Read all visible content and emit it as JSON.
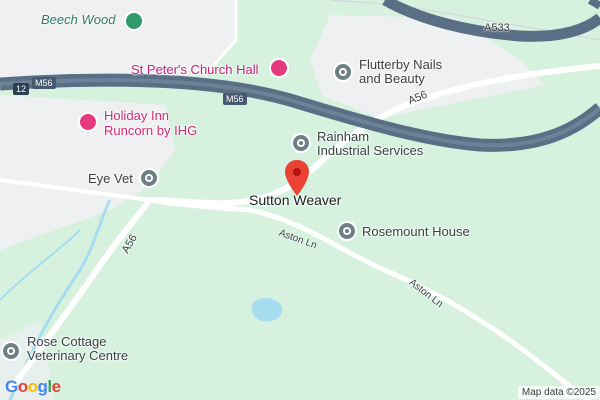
{
  "map": {
    "places": [
      {
        "id": "beech-wood",
        "label": "Beech Wood",
        "color": "#2f7d61"
      },
      {
        "id": "st-peters",
        "label": "St Peter's Church Hall",
        "color": "#c5227a"
      },
      {
        "id": "flutterby",
        "label": "Flutterby Nails\nand Beauty",
        "color": "#5f6368"
      },
      {
        "id": "holiday-inn",
        "label": "Holiday Inn\nRuncorn by IHG",
        "color": "#d42a77"
      },
      {
        "id": "rainham",
        "label": "Rainham\nIndustrial Services",
        "color": "#5f6368"
      },
      {
        "id": "eye-vet",
        "label": "Eye Vet",
        "color": "#3c4043"
      },
      {
        "id": "sutton-weaver",
        "label": "Sutton Weaver",
        "color": "#202124"
      },
      {
        "id": "rosemount",
        "label": "Rosemount House",
        "color": "#5f6368"
      },
      {
        "id": "rose-cottage",
        "label": "Rose Cottage\nVeterinary Centre",
        "color": "#5f6368"
      }
    ],
    "roads": {
      "m56_a": "M56",
      "m56_b": "M56",
      "a533": "A533",
      "a56_top": "A56",
      "a56_left": "A56",
      "aston_1": "Aston Ln",
      "aston_2": "Aston Ln",
      "junction": "12"
    },
    "logo": "Google",
    "attribution": "Map data ©2025",
    "colors": {
      "land": "#d6f2df",
      "urban": "#eef0f2",
      "motorway": "#5a6f86",
      "road": "#ffffff",
      "water": "#a7dcf0",
      "pin_red": "#ea4335"
    }
  }
}
